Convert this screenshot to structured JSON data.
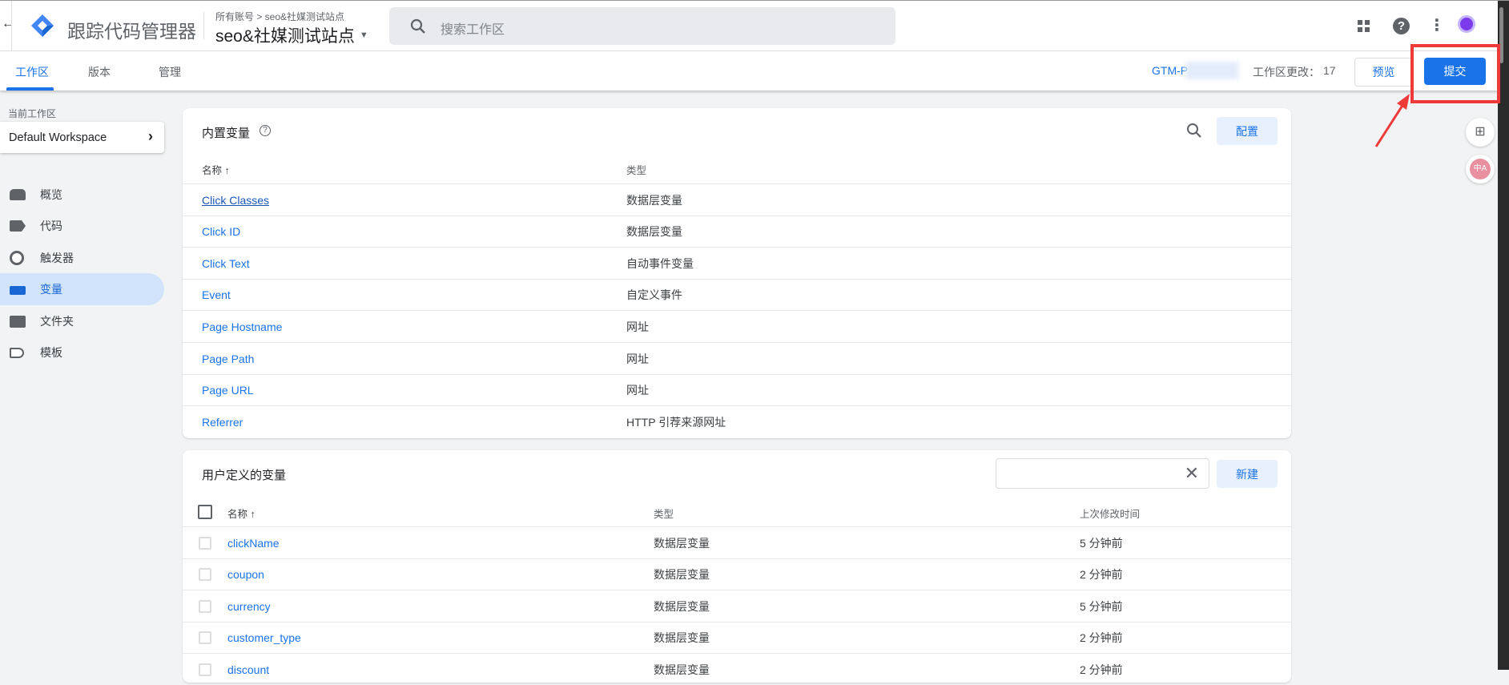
{
  "header": {
    "app_title": "跟踪代码管理器",
    "breadcrumb": "所有账号 > seo&社媒测试站点",
    "container": "seo&社媒测试站点",
    "search_placeholder": "搜索工作区"
  },
  "tabs": [
    {
      "label": "工作区"
    },
    {
      "label": "版本"
    },
    {
      "label": "管理"
    }
  ],
  "toolbar": {
    "container_id": "GTM-P",
    "changes_label": "工作区更改：",
    "changes_count": "17",
    "preview": "预览",
    "submit": "提交"
  },
  "sidebar": {
    "workspace_label": "当前工作区",
    "workspace": "Default Workspace",
    "items": [
      {
        "label": "概览"
      },
      {
        "label": "代码"
      },
      {
        "label": "触发器"
      },
      {
        "label": "变量"
      },
      {
        "label": "文件夹"
      },
      {
        "label": "模板"
      }
    ]
  },
  "builtin": {
    "title": "内置变量",
    "configure": "配置",
    "col_name": "名称 ↑",
    "col_type": "类型",
    "rows": [
      {
        "name": "Click Classes",
        "type": "数据层变量"
      },
      {
        "name": "Click ID",
        "type": "数据层变量"
      },
      {
        "name": "Click Text",
        "type": "自动事件变量"
      },
      {
        "name": "Event",
        "type": "自定义事件"
      },
      {
        "name": "Page Hostname",
        "type": "网址"
      },
      {
        "name": "Page Path",
        "type": "网址"
      },
      {
        "name": "Page URL",
        "type": "网址"
      },
      {
        "name": "Referrer",
        "type": "HTTP 引荐来源网址"
      }
    ]
  },
  "user": {
    "title": "用户定义的变量",
    "new": "新建",
    "col_name": "名称 ↑",
    "col_type": "类型",
    "col_time": "上次修改时间",
    "rows": [
      {
        "name": "clickName",
        "type": "数据层变量",
        "time": "5 分钟前"
      },
      {
        "name": "coupon",
        "type": "数据层变量",
        "time": "2 分钟前"
      },
      {
        "name": "currency",
        "type": "数据层变量",
        "time": "5 分钟前"
      },
      {
        "name": "customer_type",
        "type": "数据层变量",
        "time": "2 分钟前"
      },
      {
        "name": "discount",
        "type": "数据层变量",
        "time": "2 分钟前"
      }
    ]
  },
  "colors": {
    "accent": "#1a73e8",
    "annotation": "#f03a3a"
  }
}
